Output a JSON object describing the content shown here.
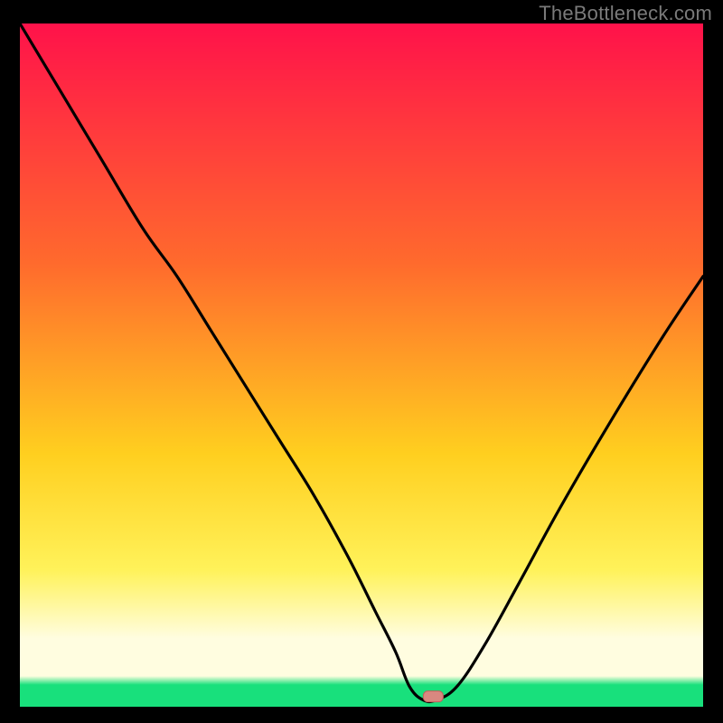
{
  "watermark": "TheBottleneck.com",
  "colors": {
    "bg_black": "#000000",
    "curve": "#000000",
    "marker_fill": "#d98880",
    "marker_stroke": "#c0605a",
    "grad_top": "#ff124a",
    "grad_upper_mid": "#ff6a2d",
    "grad_mid": "#ffcf1f",
    "grad_lower_mid": "#fff25a",
    "grad_cream": "#fffde0",
    "grad_green": "#18e07c"
  },
  "chart_data": {
    "type": "line",
    "title": "",
    "xlabel": "",
    "ylabel": "",
    "xlim": [
      0,
      100
    ],
    "ylim": [
      0,
      100
    ],
    "series": [
      {
        "name": "bottleneck-curve",
        "x": [
          0,
          6,
          12,
          18,
          23,
          28,
          33,
          38,
          43,
          48,
          52,
          55,
          57,
          59,
          61,
          64,
          68,
          73,
          79,
          86,
          94,
          100
        ],
        "y": [
          100,
          90,
          80,
          70,
          63,
          55,
          47,
          39,
          31,
          22,
          14,
          8,
          3,
          1,
          1,
          3,
          9,
          18,
          29,
          41,
          54,
          63
        ]
      }
    ],
    "flat_segment": {
      "x_start": 55,
      "x_end": 62,
      "y": 1
    },
    "marker": {
      "x": 60.5,
      "y": 1.5
    },
    "gradient_stops_pct": [
      0,
      35,
      63,
      80,
      90,
      95.5,
      96.8,
      100
    ],
    "notes": "Vertical gradient from red (top) through orange/yellow to pale cream, with a thin green band at the very bottom. Black V-shaped curve dipping to a flat minimum near x≈55–62. A small rounded salmon marker sits at the minimum."
  }
}
